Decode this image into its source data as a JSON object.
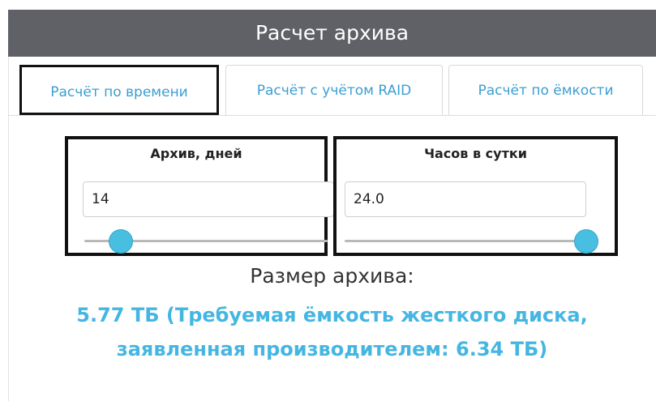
{
  "window": {
    "title": "Расчет архива"
  },
  "tabs": [
    {
      "label": "Расчёт по времени",
      "active": true
    },
    {
      "label": "Расчёт с учётом RAID",
      "active": false
    },
    {
      "label": "Расчёт по ёмкости",
      "active": false
    }
  ],
  "archive_days": {
    "label": "Архив, дней",
    "value": "14",
    "slider_fraction": 0.12
  },
  "hours_per_day": {
    "label": "Часов в сутки",
    "value": "24.0",
    "slider_fraction": 1.0
  },
  "result": {
    "title": "Размер архива:",
    "line1": "5.77 ТБ (Требуемая ёмкость жесткого диска,",
    "line2": "заявленная производителем: 6.34 ТБ)"
  },
  "colors": {
    "accent": "#45b6e2",
    "header_bg": "#5f6166",
    "slider_thumb": "#48bfe0"
  }
}
